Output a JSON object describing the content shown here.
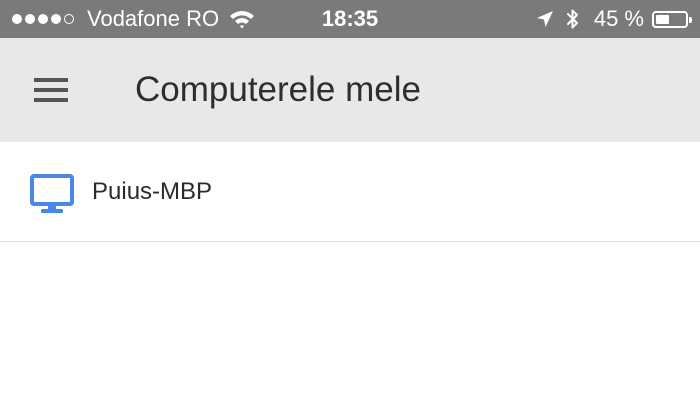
{
  "status_bar": {
    "carrier": "Vodafone RO",
    "time": "18:35",
    "battery_percent": "45 %",
    "signal_bars_filled": 4,
    "signal_bars_total": 5,
    "battery_level": 0.45,
    "icons": [
      "signal-dots-icon",
      "wifi-icon",
      "location-arrow-icon",
      "bluetooth-icon",
      "battery-icon"
    ]
  },
  "app_bar": {
    "title": "Computerele mele",
    "menu_icon": "hamburger-menu-icon",
    "background": "#e8e8e8"
  },
  "computers": [
    {
      "name": "Puius-MBP",
      "icon": "monitor-icon",
      "icon_color": "#4a86e8"
    }
  ]
}
